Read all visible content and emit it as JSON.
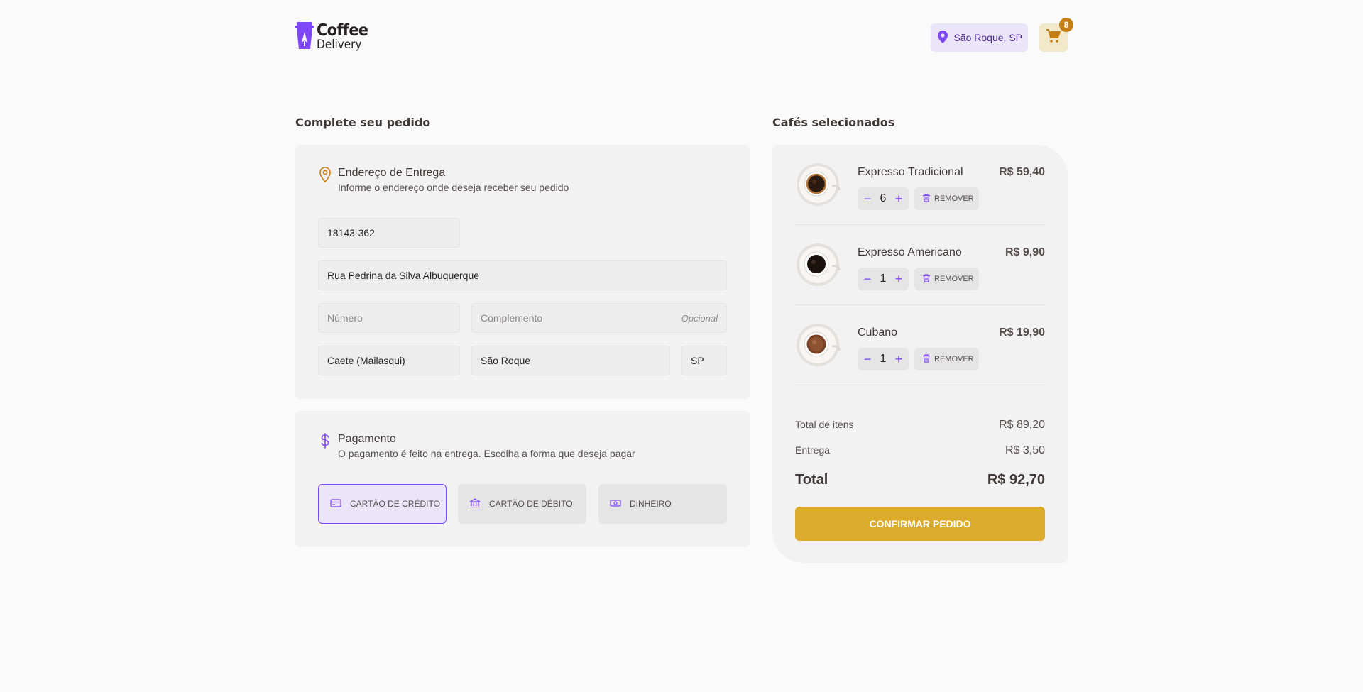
{
  "header": {
    "logo": {
      "line1": "Coffee",
      "line2": "Delivery"
    },
    "location": "São Roque, SP",
    "cart_count": "8"
  },
  "checkout": {
    "title": "Complete seu pedido",
    "address": {
      "heading": "Endereço de Entrega",
      "subheading": "Informe o endereço onde deseja receber seu pedido",
      "cep": "18143-362",
      "street": "Rua Pedrina da Silva Albuquerque",
      "number_placeholder": "Número",
      "complement_placeholder": "Complemento",
      "complement_optional": "Opcional",
      "neighborhood": "Caete (Mailasqui)",
      "city": "São Roque",
      "uf": "SP"
    },
    "payment": {
      "heading": "Pagamento",
      "subheading": "O pagamento é feito na entrega. Escolha a forma que deseja pagar",
      "options": [
        "CARTÃO DE CRÉDITO",
        "CARTÃO DE DÉBITO",
        "DINHEIRO"
      ],
      "selected": "CARTÃO DE CRÉDITO"
    }
  },
  "cart": {
    "title": "Cafés selecionados",
    "items": [
      {
        "name": "Expresso Tradicional",
        "price": "R$ 59,40",
        "qty": "6",
        "remove": "REMOVER",
        "minus": "−",
        "plus": "+"
      },
      {
        "name": "Expresso Americano",
        "price": "R$ 9,90",
        "qty": "1",
        "remove": "REMOVER",
        "minus": "−",
        "plus": "+"
      },
      {
        "name": "Cubano",
        "price": "R$ 19,90",
        "qty": "1",
        "remove": "REMOVER",
        "minus": "−",
        "plus": "+"
      }
    ],
    "summary": {
      "items_label": "Total de itens",
      "items_value": "R$ 89,20",
      "delivery_label": "Entrega",
      "delivery_value": "R$ 3,50",
      "total_label": "Total",
      "total_value": "R$ 92,70"
    },
    "confirm_label": "CONFIRMAR PEDIDO"
  },
  "colors": {
    "purple": "#8047f8",
    "purple_dark": "#4b2995",
    "yellow": "#dbac2c",
    "yellow_dark": "#c47f17"
  }
}
